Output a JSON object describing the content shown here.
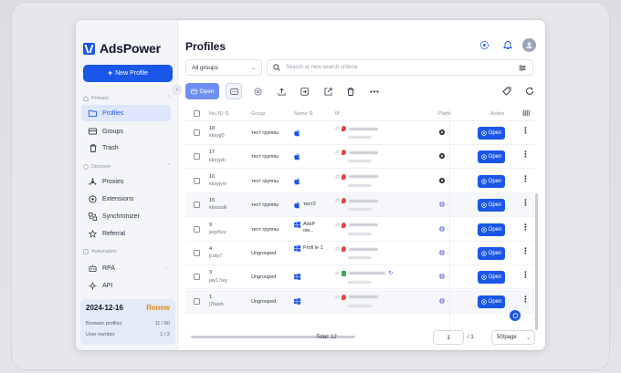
{
  "app": {
    "brand": "AdsPower",
    "new_profile_label": "New Profile",
    "collapse_glyph": "‹"
  },
  "sidebar": {
    "sections": [
      {
        "label": "Primary"
      },
      {
        "label": "Discover"
      },
      {
        "label": "Automation"
      }
    ],
    "items": [
      {
        "label": "Profiles",
        "icon": "folder-icon",
        "active": true
      },
      {
        "label": "Groups",
        "icon": "groups-icon"
      },
      {
        "label": "Trash",
        "icon": "trash-icon"
      },
      {
        "label": "Proxies",
        "icon": "proxies-icon"
      },
      {
        "label": "Extensions",
        "icon": "extensions-icon"
      },
      {
        "label": "Synchronizer",
        "icon": "synchronizer-icon"
      },
      {
        "label": "Referral",
        "icon": "star-icon"
      },
      {
        "label": "RPA",
        "icon": "rpa-icon"
      },
      {
        "label": "API",
        "icon": "api-icon"
      }
    ],
    "subscription": {
      "date": "2024-12-16",
      "renew_label": "Renew",
      "browser_profiles_label": "Browser profiles",
      "browser_profiles_value": "11 / 50",
      "user_number_label": "User number",
      "user_number_value": "1 / 2"
    }
  },
  "main": {
    "title": "Profiles",
    "group_filter": "All groups",
    "search_placeholder": "Search or new search criteria",
    "toolbar": {
      "open_label": "Open"
    },
    "table": {
      "headers": {
        "id": "No./ID",
        "group": "Group",
        "name": "Name",
        "ip": "IP",
        "platform": "Platfo",
        "action": "Action"
      },
      "rows": [
        {
          "no": "18",
          "id": "kkxyjj0",
          "group": "тест группы",
          "name": "",
          "name_icon": "apple-icon",
          "platform_icon": "x-icon"
        },
        {
          "no": "17",
          "id": "kkxyjzk",
          "group": "тест группы",
          "name": "",
          "name_icon": "apple-icon",
          "platform_icon": "x-icon"
        },
        {
          "no": "16",
          "id": "kkxyjyw",
          "group": "тест группы",
          "name": "",
          "name_icon": "apple-icon",
          "platform_icon": "x-icon"
        },
        {
          "no": "15",
          "id": "kkxssdk",
          "group": "тест группы",
          "name": "тест2",
          "name_icon": "apple-icon",
          "platform_icon": "globe-icon"
        },
        {
          "no": "9",
          "id": "jeqz5vv",
          "group": "тест группы",
          "name": "AdsP ow...",
          "name_icon": "windows-icon",
          "platform_icon": "globe-icon"
        },
        {
          "no": "4",
          "id": "jcoty7",
          "group": "Ungrouped",
          "name": "Profi le 1",
          "name_icon": "windows-icon",
          "platform_icon": "globe-icon"
        },
        {
          "no": "3",
          "id": "jav17wy",
          "group": "Ungrouped",
          "name": "",
          "name_icon": "windows-icon",
          "platform_icon": "globe-icon"
        },
        {
          "no": "1",
          "id": "j7iweb",
          "group": "Ungrouped",
          "name": "",
          "name_icon": "windows-icon",
          "platform_icon": "globe-icon"
        }
      ],
      "row_action_label": "Open"
    },
    "pagination": {
      "total_label": "Total: 12",
      "page": "1",
      "of_pages": "/ 1",
      "per_page": "50/page"
    }
  },
  "colors": {
    "accent": "#1a57e8",
    "renew": "#e58b1a",
    "sidebar_bg": "#f3f5f9",
    "active_nav_bg": "#dde6fb"
  }
}
